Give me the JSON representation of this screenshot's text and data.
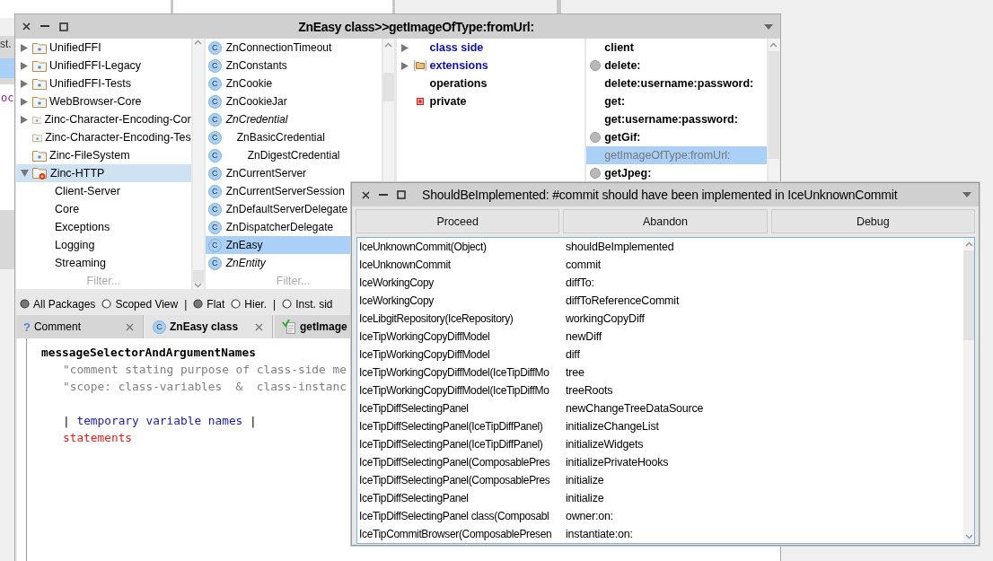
{
  "background": {
    "texts": [
      "st.",
      "oc"
    ]
  },
  "window": {
    "title": "ZnEasy class>>getImageOfType:fromUrl:",
    "packages": [
      {
        "label": "UnifiedFFI",
        "expandable": true,
        "expanded": false,
        "selected": false
      },
      {
        "label": "UnifiedFFI-Legacy",
        "expandable": true,
        "expanded": false,
        "selected": false
      },
      {
        "label": "UnifiedFFI-Tests",
        "expandable": true,
        "expanded": false,
        "selected": false
      },
      {
        "label": "WebBrowser-Core",
        "expandable": true,
        "expanded": false,
        "selected": false
      },
      {
        "label": "Zinc-Character-Encoding-Cor",
        "expandable": true,
        "expanded": false,
        "selected": false
      },
      {
        "label": "Zinc-Character-Encoding-Tes",
        "expandable": false,
        "expanded": false,
        "selected": false
      },
      {
        "label": "Zinc-FileSystem",
        "expandable": false,
        "expanded": false,
        "selected": false
      },
      {
        "label": "Zinc-HTTP",
        "expandable": true,
        "expanded": true,
        "selected": true,
        "children": [
          {
            "label": "Client-Server",
            "selected": false
          },
          {
            "label": "Core",
            "selected": false
          },
          {
            "label": "Exceptions",
            "selected": false
          },
          {
            "label": "Logging",
            "selected": false
          },
          {
            "label": "Streaming",
            "selected": false
          }
        ]
      }
    ],
    "package_filter": {
      "placeholder": "Filter..."
    },
    "classes": [
      {
        "badge": "C",
        "label": "ZnConnectionTimeout",
        "abstract": false,
        "selected": false
      },
      {
        "badge": "C",
        "label": "ZnConstants",
        "abstract": false,
        "selected": false
      },
      {
        "badge": "C",
        "label": "ZnCookie",
        "abstract": false,
        "selected": false
      },
      {
        "badge": "C",
        "label": "ZnCookieJar",
        "abstract": false,
        "selected": false
      },
      {
        "badge": "C",
        "label": "ZnCredential",
        "abstract": true,
        "selected": false,
        "children": [
          {
            "badge": "C",
            "label": "ZnBasicCredential",
            "abstract": false,
            "selected": false,
            "children": [
              {
                "badge": "C",
                "label": "ZnDigestCredential",
                "abstract": false,
                "selected": false
              }
            ]
          }
        ]
      },
      {
        "badge": "C",
        "label": "ZnCurrentServer",
        "abstract": false,
        "selected": false
      },
      {
        "badge": "C",
        "label": "ZnCurrentServerSession",
        "abstract": false,
        "selected": false
      },
      {
        "badge": "C",
        "label": "ZnDefaultServerDelegate",
        "abstract": false,
        "selected": false
      },
      {
        "badge": "C",
        "label": "ZnDispatcherDelegate",
        "abstract": false,
        "selected": false
      },
      {
        "badge": "C",
        "label": "ZnEasy",
        "abstract": false,
        "selected": true
      },
      {
        "badge": "C",
        "label": "ZnEntity",
        "abstract": true,
        "selected": false
      }
    ],
    "class_filter": {
      "placeholder": "Filter..."
    },
    "protocols": [
      {
        "label": "class side",
        "kind": "side",
        "expandable": true,
        "selected": false
      },
      {
        "label": "extensions",
        "kind": "extension",
        "expandable": true,
        "selected": false
      },
      {
        "label": "operations",
        "kind": "plain",
        "expandable": false,
        "selected": false
      },
      {
        "label": "private",
        "kind": "private",
        "expandable": false,
        "selected": false
      }
    ],
    "methods": [
      {
        "label": "client",
        "marked": false,
        "selected": false
      },
      {
        "label": "delete:",
        "marked": true,
        "selected": false
      },
      {
        "label": "delete:username:password:",
        "marked": false,
        "selected": false
      },
      {
        "label": "get:",
        "marked": false,
        "selected": false
      },
      {
        "label": "get:username:password:",
        "marked": false,
        "selected": false
      },
      {
        "label": "getGif:",
        "marked": true,
        "selected": false
      },
      {
        "label": "getImageOfType:fromUrl:",
        "marked": false,
        "selected": true
      },
      {
        "label": "getJpeg:",
        "marked": true,
        "selected": false
      }
    ],
    "scope_bar": [
      {
        "kind": "radio",
        "label": "All Packages",
        "selected": true
      },
      {
        "kind": "radio",
        "label": "Scoped View",
        "selected": false
      },
      {
        "kind": "separator",
        "label": "|"
      },
      {
        "kind": "radio",
        "label": "Flat",
        "selected": true
      },
      {
        "kind": "radio",
        "label": "Hier.",
        "selected": false
      },
      {
        "kind": "separator",
        "label": "|"
      },
      {
        "kind": "radio",
        "label": "Inst. sid",
        "selected": false
      }
    ],
    "tabs": [
      {
        "kind": "comment",
        "glyph": "?",
        "label": "Comment",
        "bold": false,
        "selected": false
      },
      {
        "kind": "class",
        "glyph": "C",
        "label": "ZnEasy class",
        "bold": true,
        "selected": true
      },
      {
        "kind": "method",
        "label": "getImage",
        "bold": true,
        "selected": false
      }
    ],
    "code": [
      {
        "kind": "selector",
        "text": "messageSelectorAndArgumentNames"
      },
      {
        "kind": "comment",
        "text": "\"comment stating purpose of class-side me"
      },
      {
        "kind": "comment",
        "text": "\"scope: class-variables  &  class-instanc"
      },
      {
        "kind": "blank"
      },
      {
        "kind": "temps",
        "open": "|",
        "text": "temporary variable names",
        "close": "|"
      },
      {
        "kind": "statement",
        "text": "statements"
      }
    ]
  },
  "dialog": {
    "title": "ShouldBeImplemented: #commit should have been implemented in IceUnknownCommit",
    "buttons": [
      "Proceed",
      "Abandon",
      "Debug"
    ],
    "stack": [
      {
        "receiver": "IceUnknownCommit(Object)",
        "selector": "shouldBeImplemented"
      },
      {
        "receiver": "IceUnknownCommit",
        "selector": "commit"
      },
      {
        "receiver": "IceWorkingCopy",
        "selector": "diffTo:"
      },
      {
        "receiver": "IceWorkingCopy",
        "selector": "diffToReferenceCommit"
      },
      {
        "receiver": "IceLibgitRepository(IceRepository)",
        "selector": "workingCopyDiff"
      },
      {
        "receiver": "IceTipWorkingCopyDiffModel",
        "selector": "newDiff"
      },
      {
        "receiver": "IceTipWorkingCopyDiffModel",
        "selector": "diff"
      },
      {
        "receiver": "IceTipWorkingCopyDiffModel(IceTipDiffMo",
        "selector": "tree"
      },
      {
        "receiver": "IceTipWorkingCopyDiffModel(IceTipDiffMo",
        "selector": "treeRoots"
      },
      {
        "receiver": "IceTipDiffSelectingPanel",
        "selector": "newChangeTreeDataSource"
      },
      {
        "receiver": "IceTipDiffSelectingPanel(IceTipDiffPanel)",
        "selector": "initializeChangeList"
      },
      {
        "receiver": "IceTipDiffSelectingPanel(IceTipDiffPanel)",
        "selector": "initializeWidgets"
      },
      {
        "receiver": "IceTipDiffSelectingPanel(ComposablePres",
        "selector": "initializePrivateHooks"
      },
      {
        "receiver": "IceTipDiffSelectingPanel(ComposablePres",
        "selector": "initialize"
      },
      {
        "receiver": "IceTipDiffSelectingPanel",
        "selector": "initialize"
      },
      {
        "receiver": "IceTipDiffSelectingPanel class(Composabl",
        "selector": "owner:on:"
      },
      {
        "receiver": "IceTipCommitBrowser(ComposablePresen",
        "selector": "instantiate:on:"
      }
    ]
  }
}
